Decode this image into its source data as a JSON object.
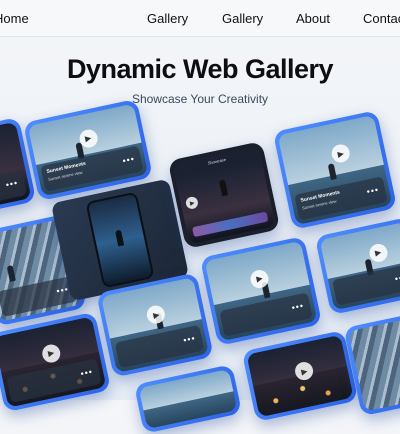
{
  "nav": {
    "items": [
      "Home",
      "Gallery",
      "Gallery",
      "About",
      "Contact"
    ]
  },
  "hero": {
    "title": "Dynamic Web Gallery",
    "subtitle": "Showcase Your Creativity"
  },
  "card_caption": {
    "title": "Sunset Moments",
    "subtitle": "Sunset serene view",
    "menu": "•••"
  },
  "app_card": {
    "header": "Showcase"
  },
  "colors": {
    "accent": "#2c63e8",
    "accent_light": "#4f8dff"
  },
  "icons": {
    "play": "play-icon",
    "more": "more-dots-icon"
  }
}
